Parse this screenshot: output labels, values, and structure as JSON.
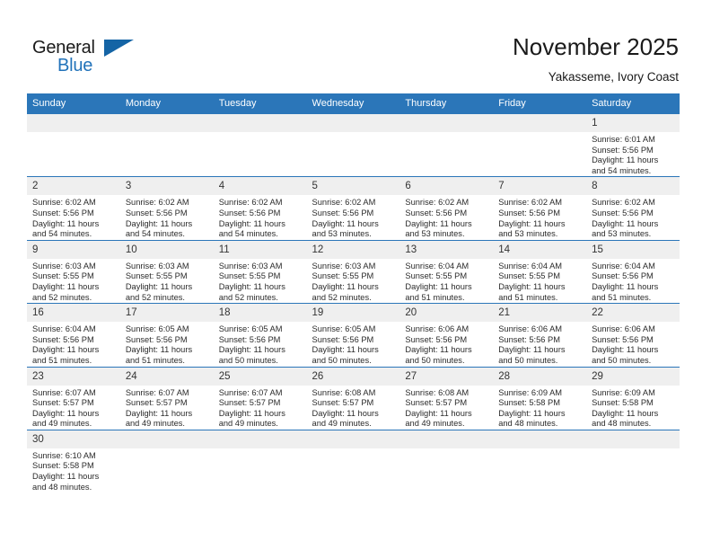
{
  "brand": {
    "name_top": "General",
    "name_bottom": "Blue",
    "logo_icon": "blue-flag-triangle",
    "accent_color": "#2b76b9"
  },
  "header": {
    "title": "November 2025",
    "subtitle": "Yakasseme, Ivory Coast"
  },
  "calendar": {
    "header_bg": "#2b76b9",
    "daynum_bg": "#efefef",
    "weekdays": [
      "Sunday",
      "Monday",
      "Tuesday",
      "Wednesday",
      "Thursday",
      "Friday",
      "Saturday"
    ],
    "weeks": [
      [
        {
          "day": "",
          "blank": true
        },
        {
          "day": "",
          "blank": true
        },
        {
          "day": "",
          "blank": true
        },
        {
          "day": "",
          "blank": true
        },
        {
          "day": "",
          "blank": true
        },
        {
          "day": "",
          "blank": true
        },
        {
          "day": "1",
          "sunrise": "Sunrise: 6:01 AM",
          "sunset": "Sunset: 5:56 PM",
          "daylight_1": "Daylight: 11 hours",
          "daylight_2": "and 54 minutes."
        }
      ],
      [
        {
          "day": "2",
          "sunrise": "Sunrise: 6:02 AM",
          "sunset": "Sunset: 5:56 PM",
          "daylight_1": "Daylight: 11 hours",
          "daylight_2": "and 54 minutes."
        },
        {
          "day": "3",
          "sunrise": "Sunrise: 6:02 AM",
          "sunset": "Sunset: 5:56 PM",
          "daylight_1": "Daylight: 11 hours",
          "daylight_2": "and 54 minutes."
        },
        {
          "day": "4",
          "sunrise": "Sunrise: 6:02 AM",
          "sunset": "Sunset: 5:56 PM",
          "daylight_1": "Daylight: 11 hours",
          "daylight_2": "and 54 minutes."
        },
        {
          "day": "5",
          "sunrise": "Sunrise: 6:02 AM",
          "sunset": "Sunset: 5:56 PM",
          "daylight_1": "Daylight: 11 hours",
          "daylight_2": "and 53 minutes."
        },
        {
          "day": "6",
          "sunrise": "Sunrise: 6:02 AM",
          "sunset": "Sunset: 5:56 PM",
          "daylight_1": "Daylight: 11 hours",
          "daylight_2": "and 53 minutes."
        },
        {
          "day": "7",
          "sunrise": "Sunrise: 6:02 AM",
          "sunset": "Sunset: 5:56 PM",
          "daylight_1": "Daylight: 11 hours",
          "daylight_2": "and 53 minutes."
        },
        {
          "day": "8",
          "sunrise": "Sunrise: 6:02 AM",
          "sunset": "Sunset: 5:56 PM",
          "daylight_1": "Daylight: 11 hours",
          "daylight_2": "and 53 minutes."
        }
      ],
      [
        {
          "day": "9",
          "sunrise": "Sunrise: 6:03 AM",
          "sunset": "Sunset: 5:55 PM",
          "daylight_1": "Daylight: 11 hours",
          "daylight_2": "and 52 minutes."
        },
        {
          "day": "10",
          "sunrise": "Sunrise: 6:03 AM",
          "sunset": "Sunset: 5:55 PM",
          "daylight_1": "Daylight: 11 hours",
          "daylight_2": "and 52 minutes."
        },
        {
          "day": "11",
          "sunrise": "Sunrise: 6:03 AM",
          "sunset": "Sunset: 5:55 PM",
          "daylight_1": "Daylight: 11 hours",
          "daylight_2": "and 52 minutes."
        },
        {
          "day": "12",
          "sunrise": "Sunrise: 6:03 AM",
          "sunset": "Sunset: 5:55 PM",
          "daylight_1": "Daylight: 11 hours",
          "daylight_2": "and 52 minutes."
        },
        {
          "day": "13",
          "sunrise": "Sunrise: 6:04 AM",
          "sunset": "Sunset: 5:55 PM",
          "daylight_1": "Daylight: 11 hours",
          "daylight_2": "and 51 minutes."
        },
        {
          "day": "14",
          "sunrise": "Sunrise: 6:04 AM",
          "sunset": "Sunset: 5:55 PM",
          "daylight_1": "Daylight: 11 hours",
          "daylight_2": "and 51 minutes."
        },
        {
          "day": "15",
          "sunrise": "Sunrise: 6:04 AM",
          "sunset": "Sunset: 5:56 PM",
          "daylight_1": "Daylight: 11 hours",
          "daylight_2": "and 51 minutes."
        }
      ],
      [
        {
          "day": "16",
          "sunrise": "Sunrise: 6:04 AM",
          "sunset": "Sunset: 5:56 PM",
          "daylight_1": "Daylight: 11 hours",
          "daylight_2": "and 51 minutes."
        },
        {
          "day": "17",
          "sunrise": "Sunrise: 6:05 AM",
          "sunset": "Sunset: 5:56 PM",
          "daylight_1": "Daylight: 11 hours",
          "daylight_2": "and 51 minutes."
        },
        {
          "day": "18",
          "sunrise": "Sunrise: 6:05 AM",
          "sunset": "Sunset: 5:56 PM",
          "daylight_1": "Daylight: 11 hours",
          "daylight_2": "and 50 minutes."
        },
        {
          "day": "19",
          "sunrise": "Sunrise: 6:05 AM",
          "sunset": "Sunset: 5:56 PM",
          "daylight_1": "Daylight: 11 hours",
          "daylight_2": "and 50 minutes."
        },
        {
          "day": "20",
          "sunrise": "Sunrise: 6:06 AM",
          "sunset": "Sunset: 5:56 PM",
          "daylight_1": "Daylight: 11 hours",
          "daylight_2": "and 50 minutes."
        },
        {
          "day": "21",
          "sunrise": "Sunrise: 6:06 AM",
          "sunset": "Sunset: 5:56 PM",
          "daylight_1": "Daylight: 11 hours",
          "daylight_2": "and 50 minutes."
        },
        {
          "day": "22",
          "sunrise": "Sunrise: 6:06 AM",
          "sunset": "Sunset: 5:56 PM",
          "daylight_1": "Daylight: 11 hours",
          "daylight_2": "and 50 minutes."
        }
      ],
      [
        {
          "day": "23",
          "sunrise": "Sunrise: 6:07 AM",
          "sunset": "Sunset: 5:57 PM",
          "daylight_1": "Daylight: 11 hours",
          "daylight_2": "and 49 minutes."
        },
        {
          "day": "24",
          "sunrise": "Sunrise: 6:07 AM",
          "sunset": "Sunset: 5:57 PM",
          "daylight_1": "Daylight: 11 hours",
          "daylight_2": "and 49 minutes."
        },
        {
          "day": "25",
          "sunrise": "Sunrise: 6:07 AM",
          "sunset": "Sunset: 5:57 PM",
          "daylight_1": "Daylight: 11 hours",
          "daylight_2": "and 49 minutes."
        },
        {
          "day": "26",
          "sunrise": "Sunrise: 6:08 AM",
          "sunset": "Sunset: 5:57 PM",
          "daylight_1": "Daylight: 11 hours",
          "daylight_2": "and 49 minutes."
        },
        {
          "day": "27",
          "sunrise": "Sunrise: 6:08 AM",
          "sunset": "Sunset: 5:57 PM",
          "daylight_1": "Daylight: 11 hours",
          "daylight_2": "and 49 minutes."
        },
        {
          "day": "28",
          "sunrise": "Sunrise: 6:09 AM",
          "sunset": "Sunset: 5:58 PM",
          "daylight_1": "Daylight: 11 hours",
          "daylight_2": "and 48 minutes."
        },
        {
          "day": "29",
          "sunrise": "Sunrise: 6:09 AM",
          "sunset": "Sunset: 5:58 PM",
          "daylight_1": "Daylight: 11 hours",
          "daylight_2": "and 48 minutes."
        }
      ],
      [
        {
          "day": "30",
          "sunrise": "Sunrise: 6:10 AM",
          "sunset": "Sunset: 5:58 PM",
          "daylight_1": "Daylight: 11 hours",
          "daylight_2": "and 48 minutes."
        },
        {
          "day": "",
          "blank": true
        },
        {
          "day": "",
          "blank": true
        },
        {
          "day": "",
          "blank": true
        },
        {
          "day": "",
          "blank": true
        },
        {
          "day": "",
          "blank": true
        },
        {
          "day": "",
          "blank": true
        }
      ]
    ]
  }
}
